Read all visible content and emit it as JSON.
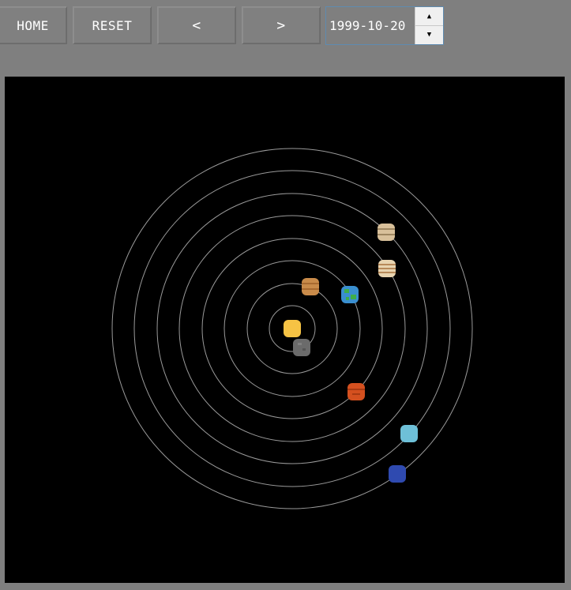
{
  "toolbar": {
    "home_label": "HOME",
    "reset_label": "RESET",
    "prev_label": "<",
    "next_label": ">",
    "date_value": "1999-10-20",
    "spin_up_glyph": "▲",
    "spin_down_glyph": "▼"
  },
  "colors": {
    "orbit": "#9a9a9a",
    "sun": "#f6c344",
    "mercury": "#6b6b6b",
    "venus": "#c98b4a",
    "earth": "#3a8fd0",
    "mars": "#d4501f",
    "jupiter": "#e8d4b0",
    "saturn": "#d8c09a",
    "uranus": "#6ec0d8",
    "neptune": "#2f4ab0"
  },
  "bodies": [
    {
      "name": "sun",
      "icon": "sun-icon"
    },
    {
      "name": "mercury",
      "icon": "mercury-icon"
    },
    {
      "name": "venus",
      "icon": "venus-icon"
    },
    {
      "name": "earth",
      "icon": "earth-icon"
    },
    {
      "name": "mars",
      "icon": "mars-icon"
    },
    {
      "name": "jupiter",
      "icon": "jupiter-icon"
    },
    {
      "name": "saturn",
      "icon": "saturn-icon"
    },
    {
      "name": "uranus",
      "icon": "uranus-icon"
    },
    {
      "name": "neptune",
      "icon": "neptune-icon"
    }
  ]
}
